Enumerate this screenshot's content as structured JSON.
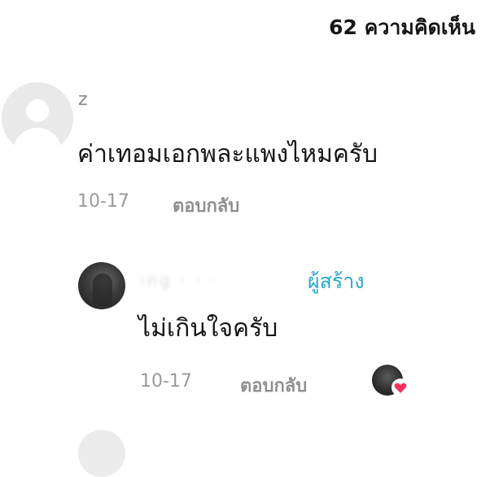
{
  "header": {
    "comment_count": "62 ความคิดเห็น"
  },
  "comments": [
    {
      "username": "z",
      "text": "ค่าเทอมเอกพละแพงไหมครับ",
      "date": "10-17",
      "reply_label": "ตอบกลับ",
      "avatar_icon": "default-user-avatar-icon",
      "replies": [
        {
          "username_blurred": "ınɡ · · ·",
          "badge": "ผู้สร้าง",
          "text": "ไม่เกินใจครับ",
          "date": "10-17",
          "reply_label": "ตอบกลับ",
          "liked_by_creator_icon": "creator-liked-heart-icon",
          "colors": {
            "badge": "#2aa9c8",
            "heart": "#f0335f"
          }
        }
      ]
    }
  ]
}
